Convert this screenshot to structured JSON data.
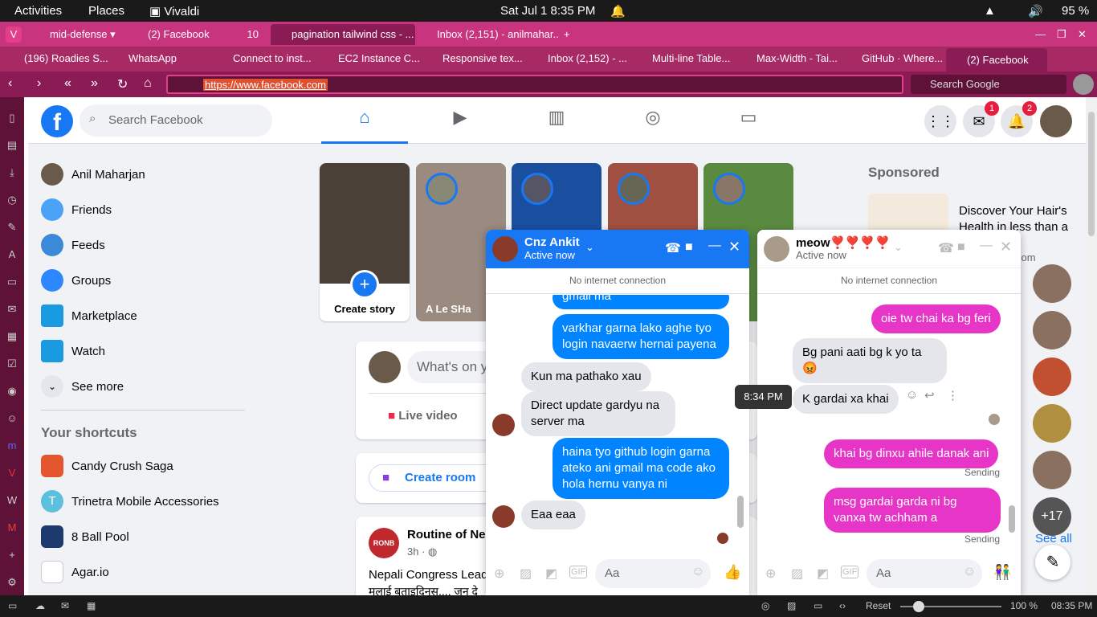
{
  "system": {
    "activities": "Activities",
    "places": "Places",
    "app": "Vivaldi",
    "datetime": "Sat Jul 1  8:35 PM",
    "battery": "95 %"
  },
  "tabs": [
    {
      "label": "mid-defense"
    },
    {
      "label": "(2) Facebook",
      "count": "10"
    },
    {
      "label": "pagination tailwind css - ..."
    },
    {
      "label": "Inbox (2,151) - anilmahar..."
    }
  ],
  "bookmarks": [
    "(196) Roadies S...",
    "WhatsApp",
    "Connect to inst...",
    "EC2 Instance C...",
    "Responsive tex...",
    "Inbox (2,152) - ...",
    "Multi-line Table...",
    "Max-Width - Tai...",
    "GitHub · Where...",
    "(2) Facebook"
  ],
  "address": {
    "url": "https://www.facebook.com",
    "search_placeholder": "Search Google"
  },
  "fb": {
    "search_placeholder": "Search Facebook",
    "messenger_badge": "1",
    "notif_badge": "2",
    "left_menu": [
      "Anil Maharjan",
      "Friends",
      "Feeds",
      "Groups",
      "Marketplace",
      "Watch",
      "See more"
    ],
    "shortcuts_title": "Your shortcuts",
    "shortcuts": [
      "Candy Crush Saga",
      "Trinetra Mobile Accessories",
      "8 Ball Pool",
      "Agar.io"
    ],
    "stories": [
      "Create story",
      "A Le SHa"
    ],
    "composer_placeholder": "What's on y",
    "live_video": "Live video",
    "create_room": "Create room",
    "post": {
      "author": "Routine of Ne",
      "time": "3h",
      "text1": "Nepali Congress Lead",
      "text2": "मलाई बताइदिनुस.... जुन दे"
    },
    "sponsored": "Sponsored",
    "ad": {
      "text": "Discover Your Hair's Health in less than a",
      "domain": "com"
    },
    "see_all": "See all",
    "more_count": "+17"
  },
  "chat1": {
    "name": "Cnz Ankit",
    "status": "Active now",
    "banner": "No internet connection",
    "messages": [
      {
        "from": "me",
        "text": "gmail ma"
      },
      {
        "from": "me",
        "text": "varkhar garna lako aghe tyo login navaerw hernai payena"
      },
      {
        "from": "them",
        "text": "Kun ma pathako xau"
      },
      {
        "from": "them",
        "text": "Direct update gardyu na server ma"
      },
      {
        "from": "me",
        "text": "haina tyo github login garna ateko ani gmail ma code ako hola hernu vanya ni"
      },
      {
        "from": "them",
        "text": "Eaa eaa"
      }
    ],
    "input": "Aa"
  },
  "chat2": {
    "name": "meow❣️❣️❣️❣️",
    "status": "Active now",
    "banner": "No internet connection",
    "messages": [
      {
        "from": "me",
        "text": "oie tw chai ka bg feri"
      },
      {
        "from": "them",
        "text": "Bg pani aati bg k yo ta 😡"
      },
      {
        "from": "them",
        "text": "K gardai xa khai"
      },
      {
        "from": "me",
        "text": "khai bg dinxu ahile danak ani"
      },
      {
        "from": "me",
        "text": "msg gardai garda ni bg vanxa tw achham a"
      }
    ],
    "tooltip": "8:34 PM",
    "sending": "Sending",
    "input": "Aa"
  },
  "statusbar": {
    "reset": "Reset",
    "zoom": "100 %",
    "time": "08:35 PM"
  },
  "colors": {
    "fb_blue": "#1877f2",
    "vivaldi_pink": "#c8347e",
    "messenger_blue": "#0084ff",
    "msg_pink": "#e735c8"
  }
}
